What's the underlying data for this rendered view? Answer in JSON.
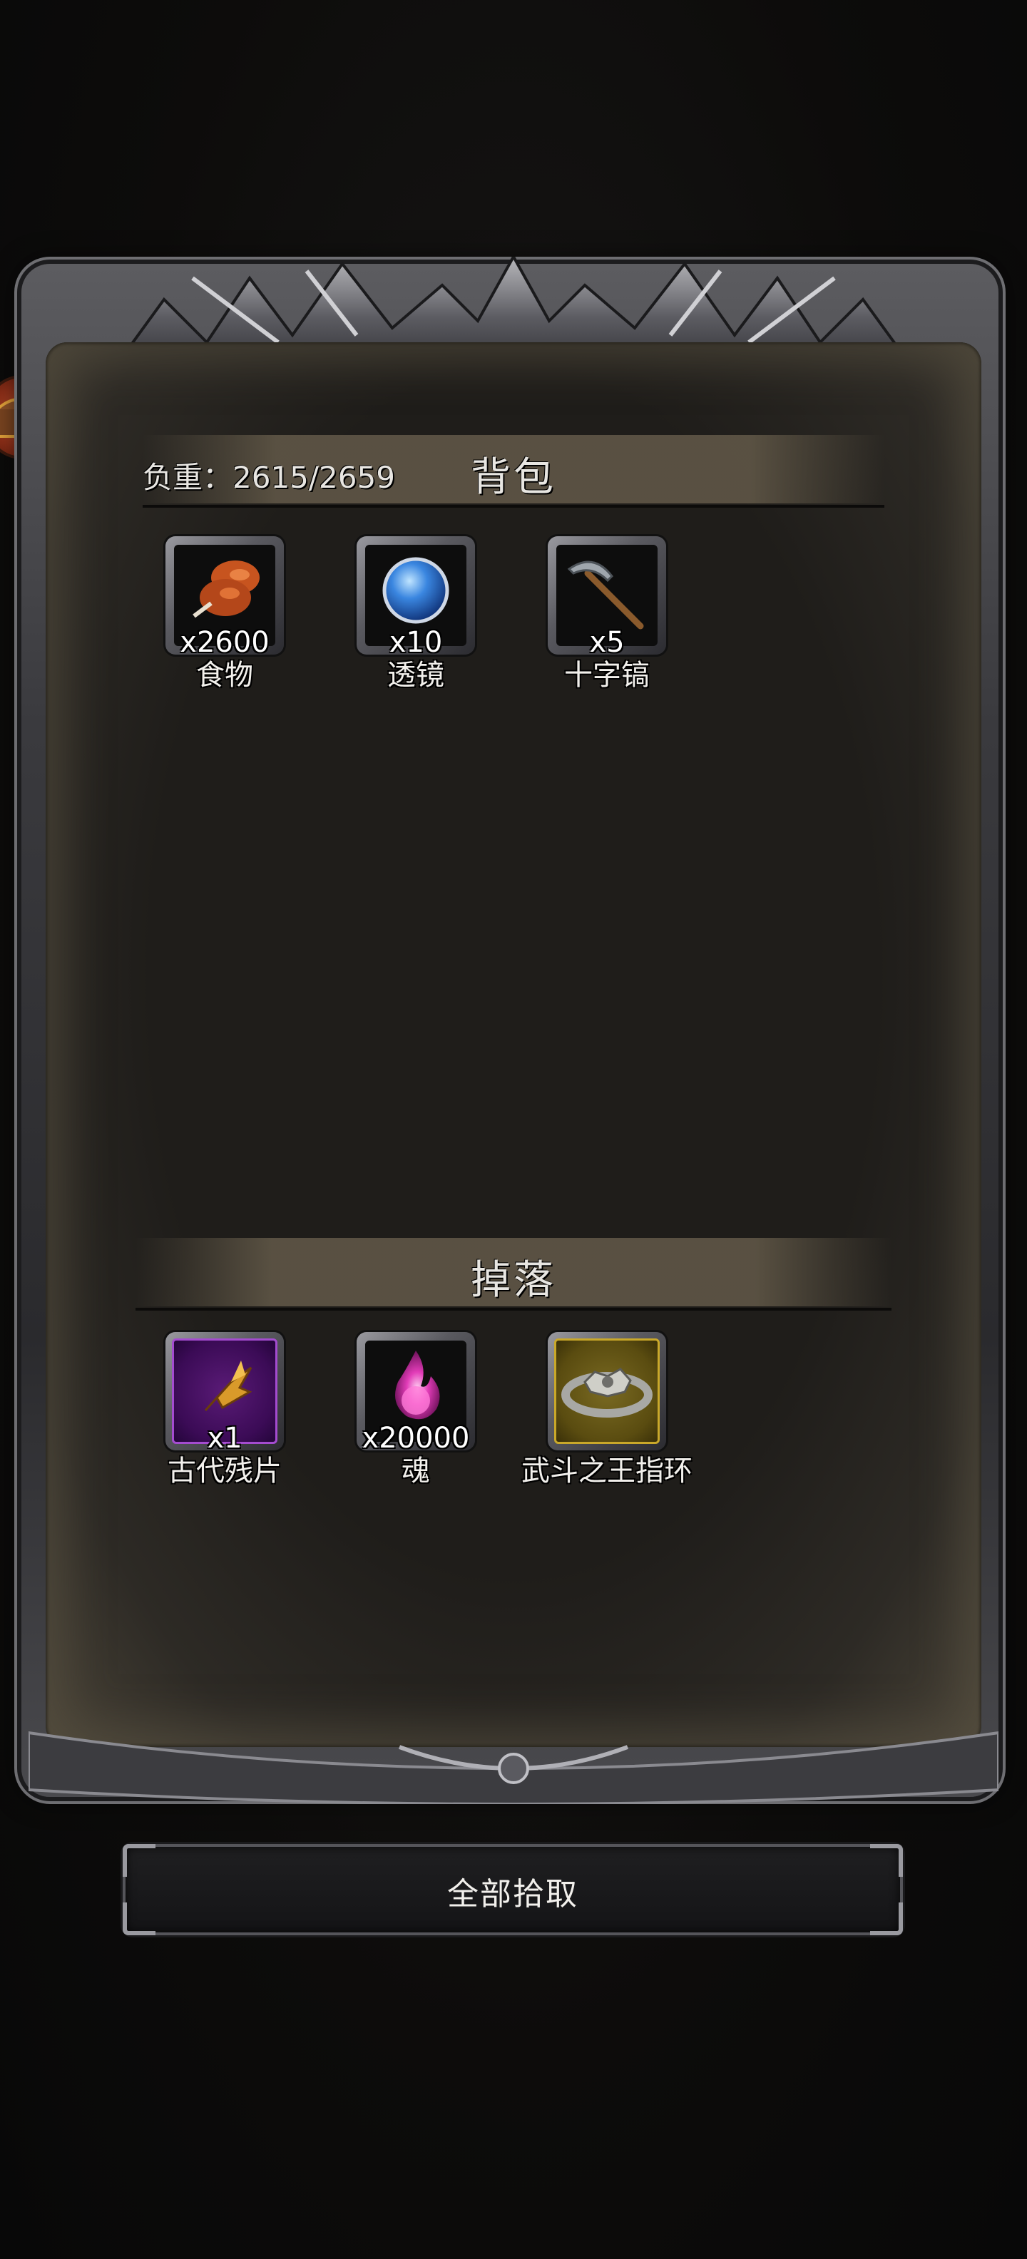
{
  "backpack": {
    "title": "背包",
    "weight_label": "负重：2615/2659",
    "items": [
      {
        "name": "食物",
        "count": "x2600",
        "icon": "meat-icon"
      },
      {
        "name": "透镜",
        "count": "x10",
        "icon": "blue-lens-icon"
      },
      {
        "name": "十字镐",
        "count": "x5",
        "icon": "pickaxe-icon"
      }
    ]
  },
  "drops": {
    "title": "掉落",
    "items": [
      {
        "name": "古代残片",
        "count": "x1",
        "icon": "ancient-shard-icon",
        "rarity_color": "#a44cd0"
      },
      {
        "name": "魂",
        "count": "x20000",
        "icon": "soul-icon",
        "rarity_color": "#6e6e72"
      },
      {
        "name": "武斗之王指环",
        "count": "",
        "icon": "ring-icon",
        "rarity_color": "#c9a82a"
      }
    ]
  },
  "actions": {
    "pickup_all_label": "全部拾取"
  },
  "side": {
    "chest_icon": "treasure-chest-icon"
  }
}
